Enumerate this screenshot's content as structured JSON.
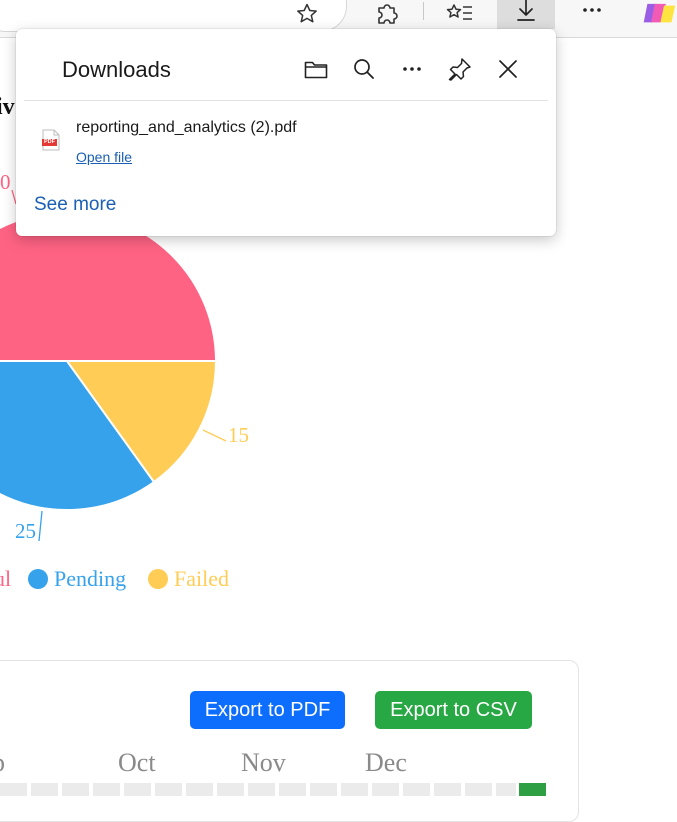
{
  "downloads": {
    "title": "Downloads",
    "file_name": "reporting_and_analytics (2).pdf",
    "open_file_label": "Open file",
    "see_more_label": "See more",
    "file_icon_text": "PDF"
  },
  "page": {
    "heading_fragment": "iv",
    "pie_labels": {
      "top": "0",
      "right": "15",
      "bottom": "25"
    },
    "legend": [
      {
        "label": "ul",
        "color": "#ff6384"
      },
      {
        "label": "Pending",
        "color": "#36a2eb"
      },
      {
        "label": "Failed",
        "color": "#ffcd56"
      }
    ],
    "export_pdf_label": "Export to PDF",
    "export_csv_label": "Export to CSV",
    "months": [
      "p",
      "Oct",
      "Nov",
      "Dec"
    ]
  },
  "colors": {
    "pink": "#ff6384",
    "blue": "#36a2eb",
    "yellow": "#ffcd56",
    "pdf_button": "#0d6efd",
    "csv_button": "#28a745",
    "link": "#1a5fb4"
  }
}
